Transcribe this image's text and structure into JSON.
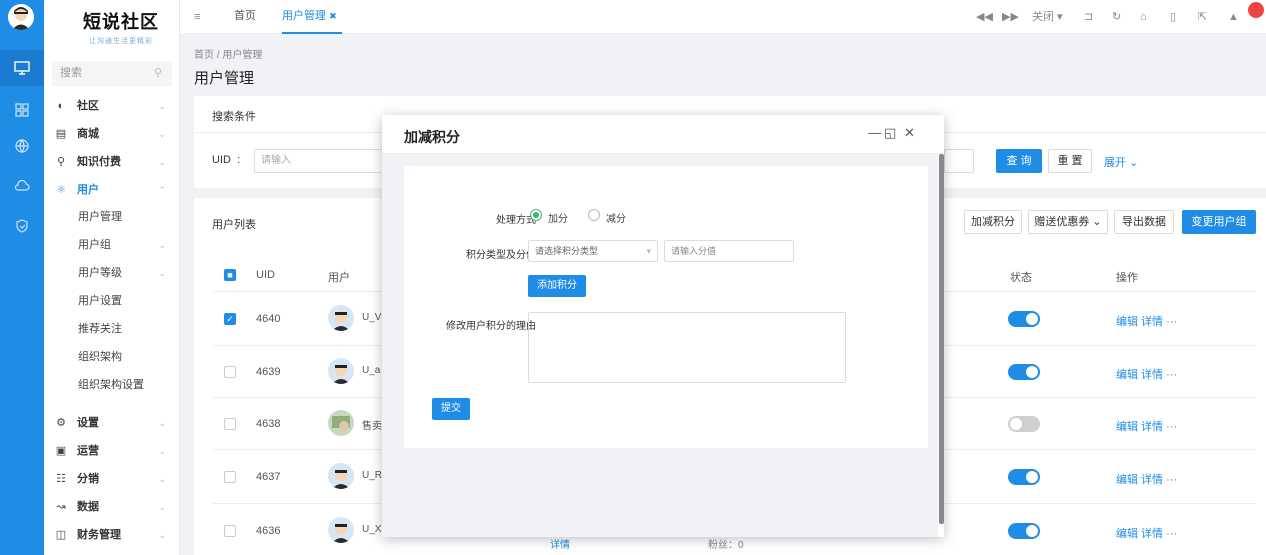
{
  "logo": {
    "title": "短说社区",
    "slogan": "让沟通生活更精彩"
  },
  "menu": {
    "search_placeholder": "搜索",
    "items": [
      {
        "label": "社区",
        "icon": "chat-icon"
      },
      {
        "label": "商城",
        "icon": "shop-icon"
      },
      {
        "label": "知识付费",
        "icon": "location-icon"
      },
      {
        "label": "用户",
        "icon": "users-icon"
      },
      {
        "label": "用户管理"
      },
      {
        "label": "用户组"
      },
      {
        "label": "用户等级"
      },
      {
        "label": "用户设置"
      },
      {
        "label": "推荐关注"
      },
      {
        "label": "组织架构"
      },
      {
        "label": "组织架构设置"
      },
      {
        "label": "设置",
        "icon": "gear-icon"
      },
      {
        "label": "运营",
        "icon": "monitor-icon"
      },
      {
        "label": "分销",
        "icon": "sitemap-icon"
      },
      {
        "label": "数据",
        "icon": "chart-icon"
      },
      {
        "label": "财务管理",
        "icon": "finance-icon"
      }
    ]
  },
  "topbar": {
    "tabs": [
      "首页",
      "用户管理"
    ],
    "close_label": "关闭"
  },
  "breadcrumb": "首页 / 用户管理",
  "page_title": "用户管理",
  "search_card": {
    "title": "搜索条件",
    "uid_label": "UID",
    "uid_placeholder": "请输入",
    "query": "查 询",
    "reset": "重 置",
    "expand": "展开"
  },
  "list_card": {
    "title": "用户列表",
    "buttons": [
      "加减积分",
      "赠送优惠券",
      "导出数据",
      "变更用户组"
    ],
    "columns": {
      "uid": "UID",
      "user": "用户",
      "status": "状态",
      "action": "操作"
    },
    "actions": "编辑 详情 ···",
    "rows": [
      {
        "uid": "4640",
        "name": "U_V",
        "checked": true,
        "status": true
      },
      {
        "uid": "4639",
        "name": "U_a",
        "checked": false,
        "status": true
      },
      {
        "uid": "4638",
        "name": "售卖",
        "checked": false,
        "status": false
      },
      {
        "uid": "4637",
        "name": "U_R",
        "checked": false,
        "status": true
      },
      {
        "uid": "4636",
        "name": "U_X",
        "checked": false,
        "status": true
      }
    ],
    "footer_left": "详情",
    "footer_mid": "粉丝：0"
  },
  "modal": {
    "title": "加减积分",
    "method_label": "处理方式",
    "add_option": "加分",
    "sub_option": "减分",
    "type_label": "积分类型及分值",
    "type_placeholder": "请选择积分类型",
    "score_placeholder": "请输入分值",
    "add_button": "添加积分",
    "reason_label": "修改用户积分的理由",
    "submit": "提交"
  }
}
